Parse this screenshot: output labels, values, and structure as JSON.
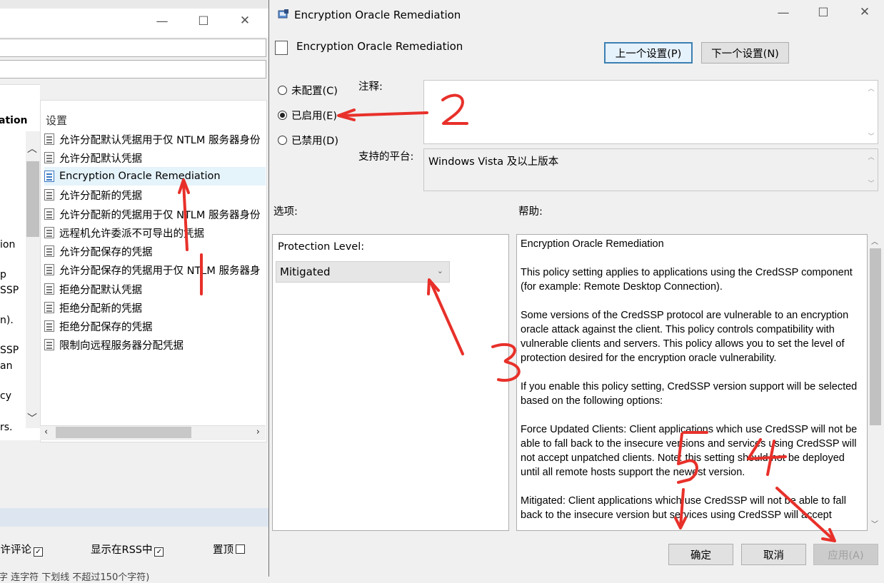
{
  "background_window": {
    "tree_fragments": [
      "ation",
      "ion",
      "p",
      "SSP",
      "n).",
      "SSP",
      "an",
      "cy",
      "rs."
    ],
    "list_header": "设置",
    "items": [
      {
        "label": "允许分配默认凭据用于仅 NTLM 服务器身份"
      },
      {
        "label": "允许分配默认凭据"
      },
      {
        "label": "Encryption Oracle Remediation"
      },
      {
        "label": "允许分配新的凭据"
      },
      {
        "label": "允许分配新的凭据用于仅 NTLM 服务器身份"
      },
      {
        "label": "远程机允许委派不可导出的凭据"
      },
      {
        "label": "允许分配保存的凭据"
      },
      {
        "label": "允许分配保存的凭据用于仅 NTLM 服务器身"
      },
      {
        "label": "拒绝分配默认凭据"
      },
      {
        "label": "拒绝分配新的凭据"
      },
      {
        "label": "拒绝分配保存的凭据"
      },
      {
        "label": "限制向远程服务器分配凭据"
      }
    ],
    "bottom": {
      "allow_comments": "允许评论",
      "show_rss": "显示在RSS中",
      "pin_top": "置顶",
      "footer_text": "字 连字符 下划线 不超过150个字符)"
    }
  },
  "dialog": {
    "title": "Encryption Oracle Remediation",
    "policy_name": "Encryption Oracle Remediation",
    "prev_button": "上一个设置(P)",
    "next_button": "下一个设置(N)",
    "radio_not_configured": "未配置(C)",
    "radio_enabled": "已启用(E)",
    "radio_disabled": "已禁用(D)",
    "comment_label": "注释:",
    "comment_value": "",
    "platform_label": "支持的平台:",
    "platform_value": "Windows Vista 及以上版本",
    "options_label": "选项:",
    "help_label": "帮助:",
    "protection_level_label": "Protection Level:",
    "protection_level_value": "Mitigated",
    "help_paragraphs": [
      "Encryption Oracle Remediation",
      "This policy setting applies to applications using the CredSSP component (for example: Remote Desktop Connection).",
      "Some versions of the CredSSP protocol are vulnerable to an encryption oracle attack against the client.  This policy controls compatibility with vulnerable clients and servers.  This policy allows you to set the level of protection desired for the encryption oracle vulnerability.",
      "If you enable this policy setting, CredSSP version support will be selected based on the following options:",
      "Force Updated Clients: Client applications which use CredSSP will not be able to fall back to the insecure versions and services using CredSSP will not accept unpatched clients. Note: this setting should not be deployed until all remote hosts support the newest version.",
      "Mitigated: Client applications which use CredSSP will not be able to fall back to the insecure version but services using CredSSP will accept"
    ],
    "ok_button": "确定",
    "cancel_button": "取消",
    "apply_button": "应用(A)"
  },
  "annotation_color": "#e8302a"
}
